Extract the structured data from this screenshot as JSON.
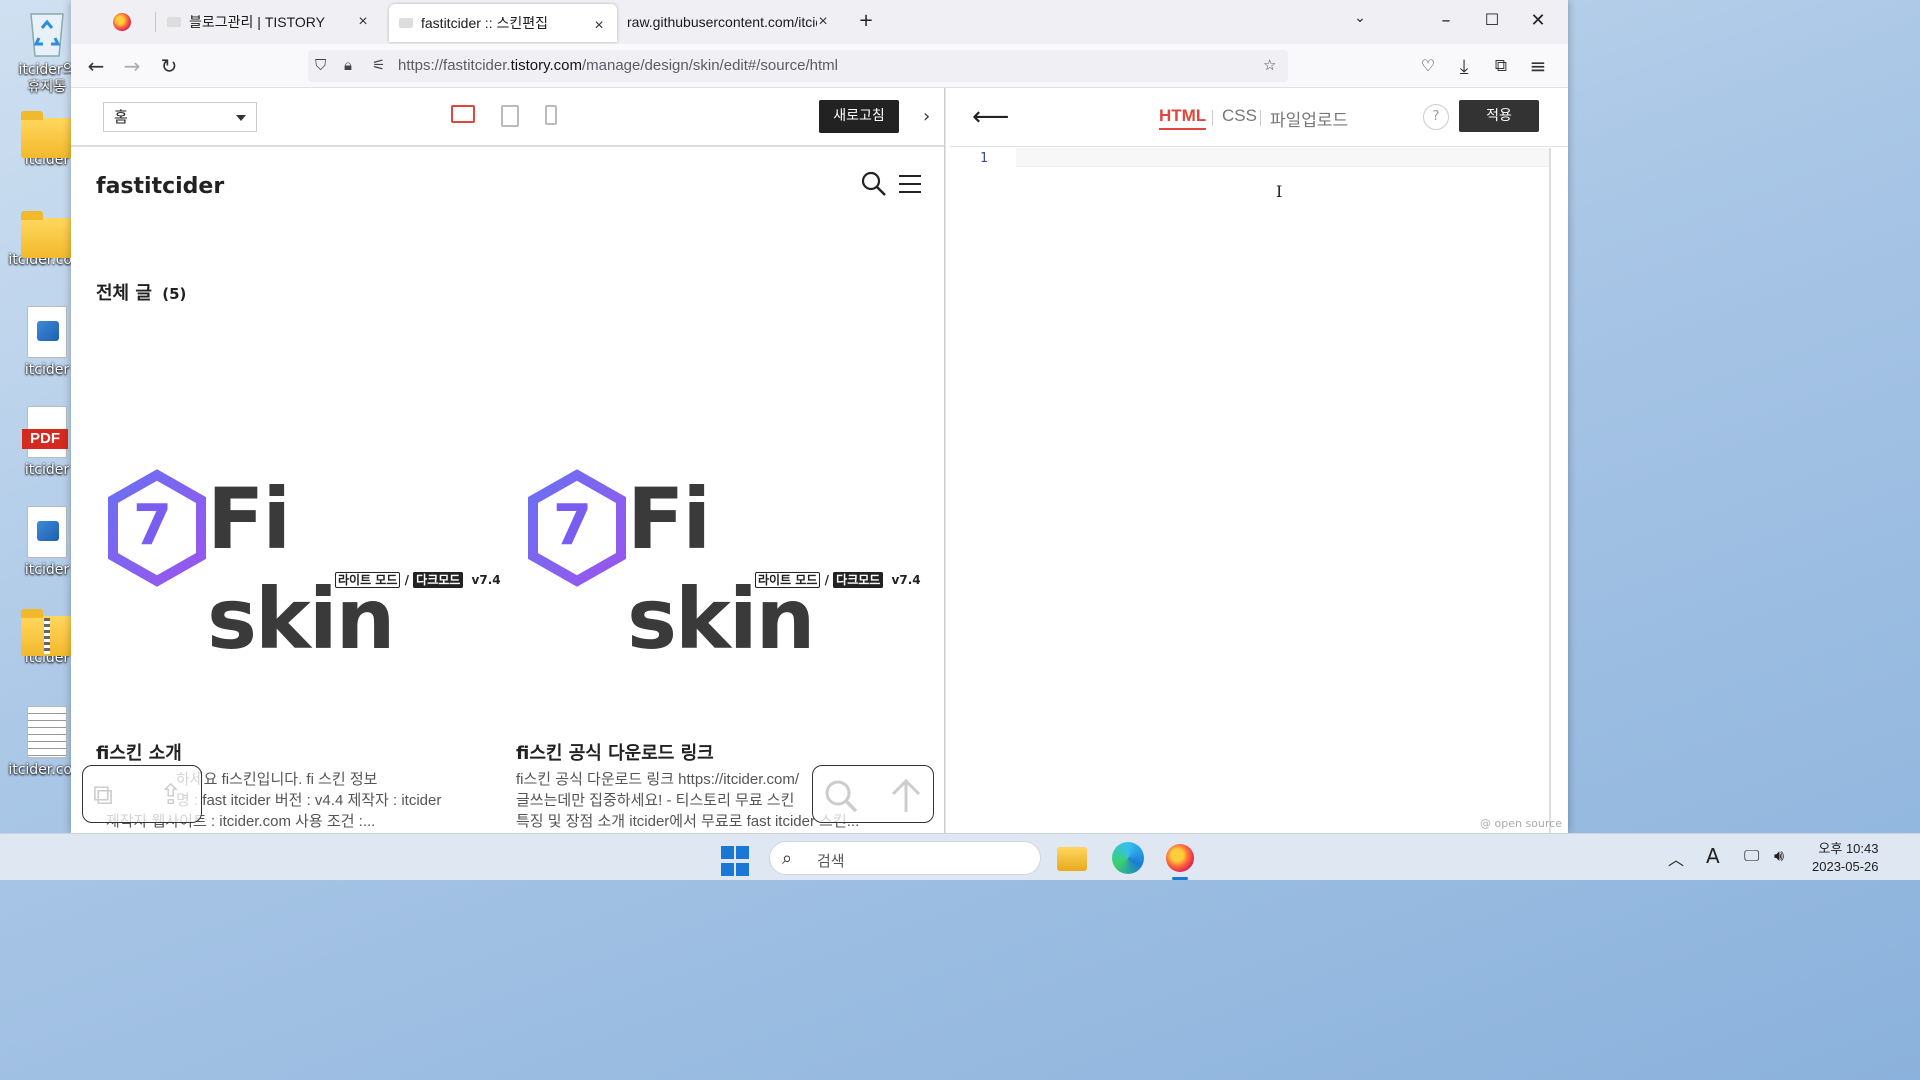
{
  "desktop": {
    "icons": [
      {
        "label": "itcider의\n휴지통",
        "type": "bin"
      },
      {
        "label": "itcider",
        "type": "folder"
      },
      {
        "label": "itcider.com",
        "type": "folder"
      },
      {
        "label": "itcider",
        "type": "image"
      },
      {
        "label": "itcider",
        "type": "pdf",
        "badge": "PDF"
      },
      {
        "label": "itcider",
        "type": "image"
      },
      {
        "label": "itcider",
        "type": "zip"
      },
      {
        "label": "itcider.com",
        "type": "text"
      }
    ]
  },
  "browser": {
    "tabs": [
      {
        "label": "블로그관리 | TISTORY",
        "icon": "tistory-icon"
      },
      {
        "label": "fastitcider :: 스킨편집",
        "icon": "tistory-icon",
        "active": true
      },
      {
        "label": "raw.githubusercontent.com/itcider/",
        "icon": "none"
      }
    ],
    "url_host": "https://fastitcider.",
    "url_domain": "tistory.com",
    "url_path": "/manage/design/skin/edit#/source/html"
  },
  "preview": {
    "page_select": "홈",
    "refresh_label": "새로고침",
    "site_title": "fastitcider",
    "all_posts_label": "전체 글",
    "all_posts_count": "(5)",
    "logo_text": "Fi skin",
    "logo_badge_number": "7",
    "logo_light": "라이트 모드",
    "logo_slash": "/",
    "logo_dark": "다크모드",
    "logo_version": "v7.4",
    "posts": [
      {
        "title": "fi스킨 소개",
        "excerpt_lines": [
          "하세요 fi스킨입니다. fi 스킨 정보",
          "명 : fast itcider 버전 : v4.4 제작자 : itcider",
          "제작자 웹사이트 : itcider.com 사용 조건 :..."
        ]
      },
      {
        "title": "fi스킨 공식 다운로드 링크",
        "excerpt_lines": [
          "fi스킨 공식 다운로드 링크 https://itcider.com/",
          "글쓰는데만 집중하세요! - 티스토리 무료 스킨",
          "특징 및 장점 소개 itcider에서 무료로 fast itcider 스킨..."
        ]
      }
    ]
  },
  "editor": {
    "tabs": [
      "HTML",
      "CSS",
      "파일업로드"
    ],
    "active_tab": "HTML",
    "help_label": "?",
    "apply_label": "적용",
    "line_number": "1",
    "footer_note": "@ open source"
  },
  "taskbar": {
    "search_placeholder": "검색",
    "ime_label": "A",
    "time": "오후 10:43",
    "date": "2023-05-26"
  },
  "colors": {
    "accent_red": "#e2453c",
    "logo_purple": "#7b5cf0",
    "windows_blue": "#1a78d4"
  }
}
